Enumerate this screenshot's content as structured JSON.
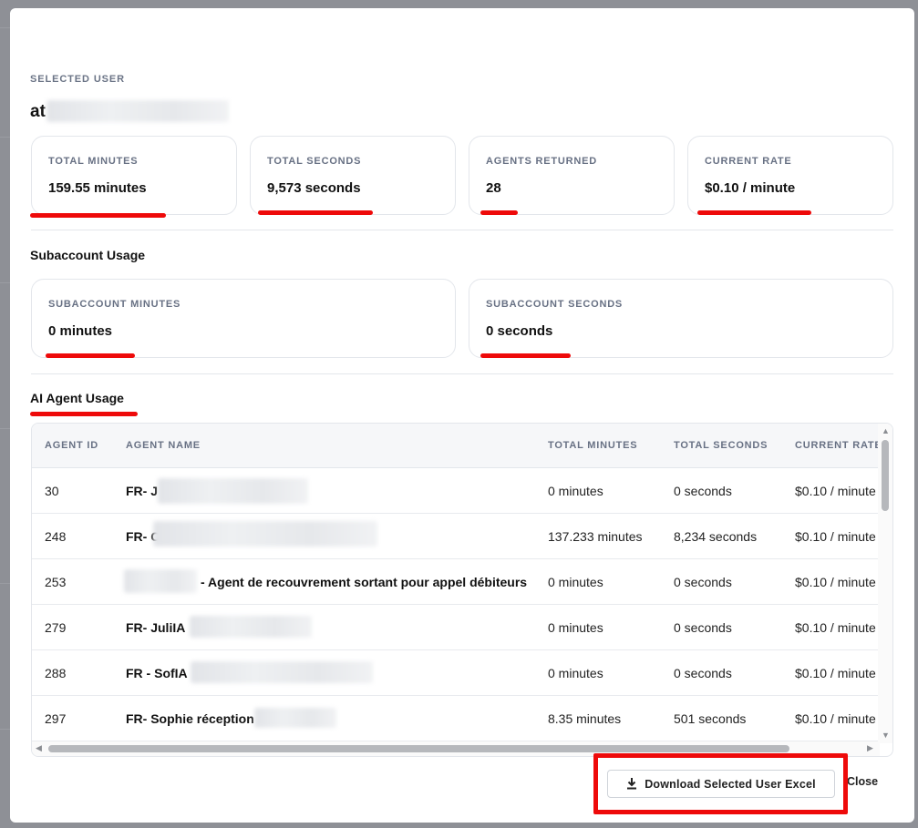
{
  "selected_user": {
    "label": "SELECTED USER",
    "name_visible": "at"
  },
  "stats": [
    {
      "label": "TOTAL MINUTES",
      "value": "159.55 minutes"
    },
    {
      "label": "TOTAL SECONDS",
      "value": "9,573 seconds"
    },
    {
      "label": "AGENTS RETURNED",
      "value": "28"
    },
    {
      "label": "CURRENT RATE",
      "value": "$0.10 / minute"
    }
  ],
  "subaccount": {
    "heading": "Subaccount Usage",
    "cards": [
      {
        "label": "SUBACCOUNT MINUTES",
        "value": "0 minutes"
      },
      {
        "label": "SUBACCOUNT SECONDS",
        "value": "0 seconds"
      }
    ]
  },
  "agent_usage": {
    "heading": "AI Agent Usage",
    "columns": [
      "AGENT ID",
      "AGENT NAME",
      "TOTAL MINUTES",
      "TOTAL SECONDS",
      "CURRENT RATE"
    ],
    "rows": [
      {
        "id": "30",
        "name": "FR- J",
        "minutes": "0 minutes",
        "seconds": "0 seconds",
        "rate": "$0.10 / minute"
      },
      {
        "id": "248",
        "name": "FR- C",
        "minutes": "137.233 minutes",
        "seconds": "8,234 seconds",
        "rate": "$0.10 / minute"
      },
      {
        "id": "253",
        "name": "- Agent de recouvrement sortant pour appel débiteurs",
        "minutes": "0 minutes",
        "seconds": "0 seconds",
        "rate": "$0.10 / minute"
      },
      {
        "id": "279",
        "name": "FR- JuliIA",
        "minutes": "0 minutes",
        "seconds": "0 seconds",
        "rate": "$0.10 / minute"
      },
      {
        "id": "288",
        "name": "FR - SofIA",
        "minutes": "0 minutes",
        "seconds": "0 seconds",
        "rate": "$0.10 / minute"
      },
      {
        "id": "297",
        "name": "FR- Sophie réception",
        "minutes": "8.35 minutes",
        "seconds": "501 seconds",
        "rate": "$0.10 / minute"
      }
    ]
  },
  "actions": {
    "download_label": "Download Selected User Excel",
    "close_label": "Close"
  },
  "icons": {
    "download": "download-icon",
    "scroll_up": "arrow-up-icon",
    "scroll_down": "arrow-down-icon",
    "scroll_left": "arrow-left-icon",
    "scroll_right": "arrow-right-icon"
  },
  "colors": {
    "annotation_red": "#ee0a0a",
    "label_gray": "#687184"
  }
}
